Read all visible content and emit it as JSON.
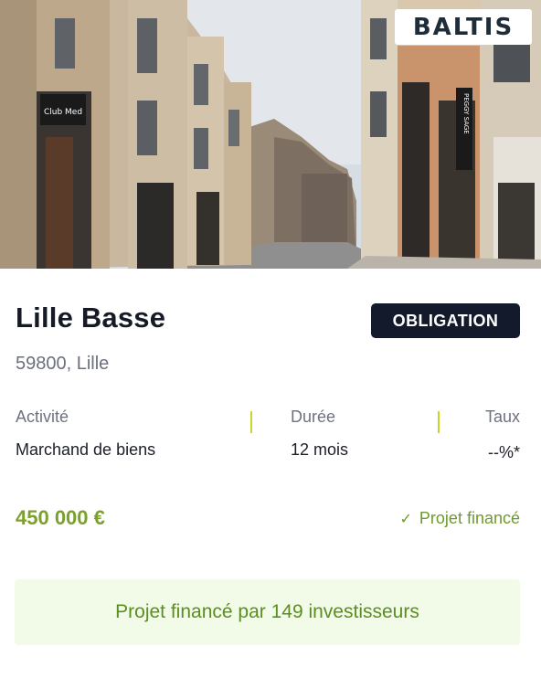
{
  "card": {
    "brand": "BALTIS",
    "title": "Lille Basse",
    "type_badge": "OBLIGATION",
    "location": "59800, Lille",
    "stats": {
      "activity_label": "Activité",
      "activity_value": "Marchand de biens",
      "duration_label": "Durée",
      "duration_value": "12 mois",
      "rate_label": "Taux",
      "rate_value": "--%*"
    },
    "amount": "450 000 €",
    "status": "Projet financé",
    "status_icon": "check-icon",
    "banner": "Projet financé par 149 investisseurs",
    "photo_signs": [
      "Club Med",
      "PEGGY SAGE"
    ],
    "colors": {
      "accent_green": "#7ca02d",
      "badge_dark": "#121a2c",
      "banner_bg": "#f2fbe8",
      "divider": "#c8d62a"
    }
  }
}
